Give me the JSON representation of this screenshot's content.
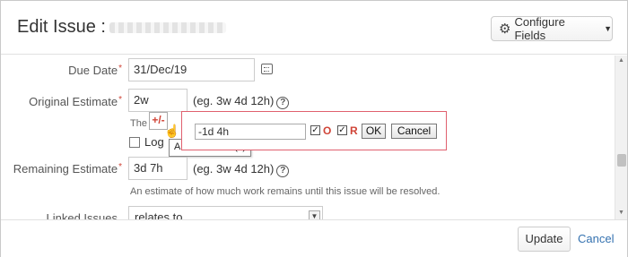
{
  "dialog": {
    "title": "Edit Issue :",
    "configure_label": "Configure Fields"
  },
  "form": {
    "due_date": {
      "label": "Due Date",
      "value": "31/Dec/19"
    },
    "original_estimate": {
      "label": "Original Estimate",
      "value": "2w",
      "hint": "(eg. 3w 4d 12h)",
      "desc_start": "The o"
    },
    "adjust": {
      "button_label": "+/-",
      "tooltip": "Alter estimate(s)",
      "value": "-1d 4h",
      "o_label": "O",
      "r_label": "R",
      "ok_label": "OK",
      "cancel_label": "Cancel"
    },
    "log_label": "Log",
    "remaining_estimate": {
      "label": "Remaining Estimate",
      "value": "3d 7h",
      "hint": "(eg. 3w 4d 12h)",
      "description": "An estimate of how much work remains until this issue will be resolved."
    },
    "linked_issues": {
      "label": "Linked Issues",
      "value": "relates to"
    }
  },
  "footer": {
    "update_label": "Update",
    "cancel_label": "Cancel"
  }
}
